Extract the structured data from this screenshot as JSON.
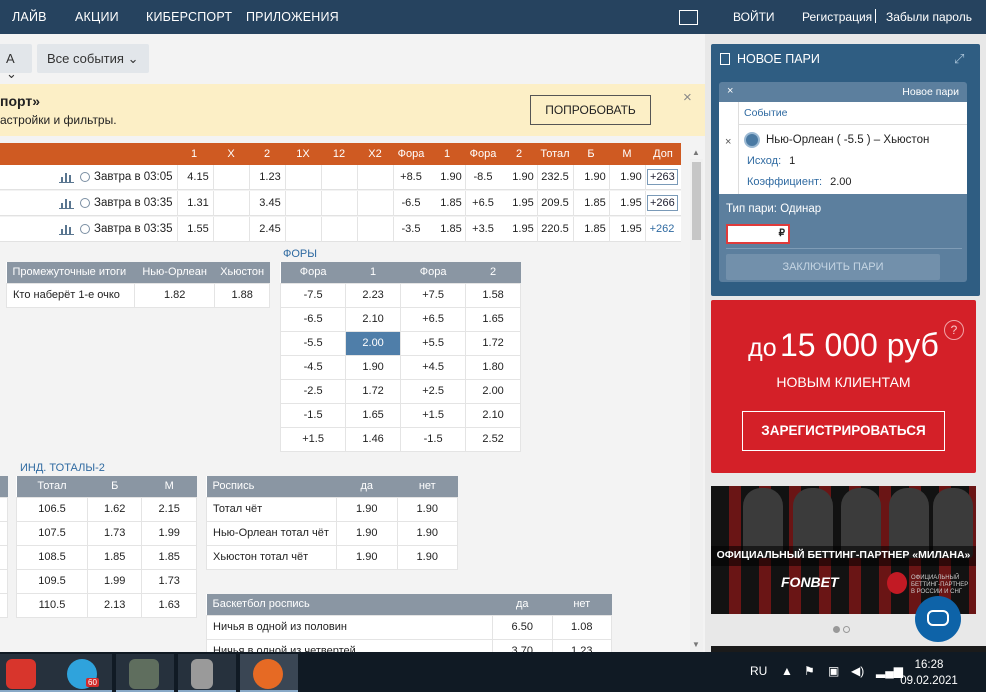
{
  "nav": {
    "left": [
      "ЛАЙВ",
      "АКЦИИ",
      "КИБЕРСПОРТ",
      "ПРИЛОЖЕНИЯ"
    ],
    "login": "ВОЙТИ",
    "register": "Регистрация",
    "forgot": "Забыли пароль"
  },
  "filters": {
    "first": "А",
    "events": "Все события"
  },
  "promo": {
    "title": "порт»",
    "text": "астройки и фильтры.",
    "button": "ПОПРОБОВАТЬ"
  },
  "header_cols": [
    "1",
    "X",
    "2",
    "1X",
    "12",
    "X2",
    "Фора",
    "1",
    "Фора",
    "2",
    "Тотал",
    "Б",
    "М",
    "Доп"
  ],
  "matches": [
    {
      "time": "Завтра в 03:05",
      "v1": "4.15",
      "vx": "",
      "v2": "1.23",
      "fora1": "+8.5",
      "k1": "1.90",
      "fora2": "-8.5",
      "k2": "1.90",
      "total": "232.5",
      "b": "1.90",
      "m": "1.90",
      "extra": "+263"
    },
    {
      "time": "Завтра в 03:35",
      "v1": "1.31",
      "vx": "",
      "v2": "3.45",
      "fora1": "-6.5",
      "k1": "1.85",
      "fora2": "+6.5",
      "k2": "1.95",
      "total": "209.5",
      "b": "1.85",
      "m": "1.95",
      "extra": "+266"
    },
    {
      "time": "Завтра в 03:35",
      "v1": "1.55",
      "vx": "",
      "v2": "2.45",
      "fora1": "-3.5",
      "k1": "1.85",
      "fora2": "+3.5",
      "k2": "1.95",
      "total": "220.5",
      "b": "1.85",
      "m": "1.95",
      "extra": "+262"
    }
  ],
  "intermediate": {
    "headers": [
      "Промежуточные итоги",
      "Нью-Орлеан",
      "Хьюстон"
    ],
    "rows": [
      [
        "Кто наберёт 1-е очко",
        "1.82",
        "1.88"
      ]
    ]
  },
  "foras": {
    "title": "ФОРЫ",
    "headers": [
      "Фора",
      "1",
      "Фора",
      "2"
    ],
    "rows": [
      [
        "-7.5",
        "2.23",
        "+7.5",
        "1.58"
      ],
      [
        "-6.5",
        "2.10",
        "+6.5",
        "1.65"
      ],
      [
        "-5.5",
        "2.00",
        "+5.5",
        "1.72"
      ],
      [
        "-4.5",
        "1.90",
        "+4.5",
        "1.80"
      ],
      [
        "-2.5",
        "1.72",
        "+2.5",
        "2.00"
      ],
      [
        "-1.5",
        "1.65",
        "+1.5",
        "2.10"
      ],
      [
        "+1.5",
        "1.46",
        "-1.5",
        "2.52"
      ]
    ]
  },
  "ind_totals": {
    "title": "ИНД. ТОТАЛЫ-2",
    "headers": [
      "Тотал",
      "Б",
      "М"
    ],
    "rows": [
      [
        "106.5",
        "1.62",
        "2.15"
      ],
      [
        "107.5",
        "1.73",
        "1.99"
      ],
      [
        "108.5",
        "1.85",
        "1.85"
      ],
      [
        "109.5",
        "1.99",
        "1.73"
      ],
      [
        "110.5",
        "2.13",
        "1.63"
      ]
    ]
  },
  "rospis": {
    "headers": [
      "Роспись",
      "да",
      "нет"
    ],
    "rows": [
      [
        "Тотал чёт",
        "1.90",
        "1.90"
      ],
      [
        "Нью-Орлеан тотал чёт",
        "1.90",
        "1.90"
      ],
      [
        "Хьюстон тотал чёт",
        "1.90",
        "1.90"
      ]
    ]
  },
  "basket": {
    "headers": [
      "Баскетбол роспись",
      "да",
      "нет"
    ],
    "rows": [
      [
        "Ничья в одной из половин",
        "6.50",
        "1.08"
      ],
      [
        "Ничья в одной из четвертей",
        "3.70",
        "1.23"
      ]
    ]
  },
  "betslip": {
    "title": "НОВОЕ ПАРИ",
    "close": "×",
    "new": "Новое пари",
    "event_label": "Событие",
    "teams": "Нью-Орлеан ( -5.5 ) – Хьюстон",
    "outcome_label": "Исход:",
    "outcome": "1",
    "coef_label": "Коэффициент:",
    "coef": "2.00",
    "type": "Тип пари: Одинар",
    "currency": "₽",
    "submit": "ЗАКЛЮЧИТЬ ПАРИ",
    "remove": "×"
  },
  "ad": {
    "pre": "до",
    "amount": "15 000 руб",
    "sub": "НОВЫМ КЛИЕНТАМ",
    "cta": "ЗАРЕГИСТРИРОВАТЬСЯ",
    "help": "?"
  },
  "ad2": {
    "partner": "ОФИЦИАЛЬНЫЙ БЕТТИНГ-ПАРТНЕР «МИЛАНА»",
    "brand": "FONBET",
    "small": "ОФИЦИАЛЬНЫЙ БЕТТИНГ-ПАРТНЕР В РОССИИ И СНГ"
  },
  "taskbar": {
    "lang": "RU",
    "time": "16:28",
    "date": "09.02.2021",
    "tg_badge": "60"
  }
}
